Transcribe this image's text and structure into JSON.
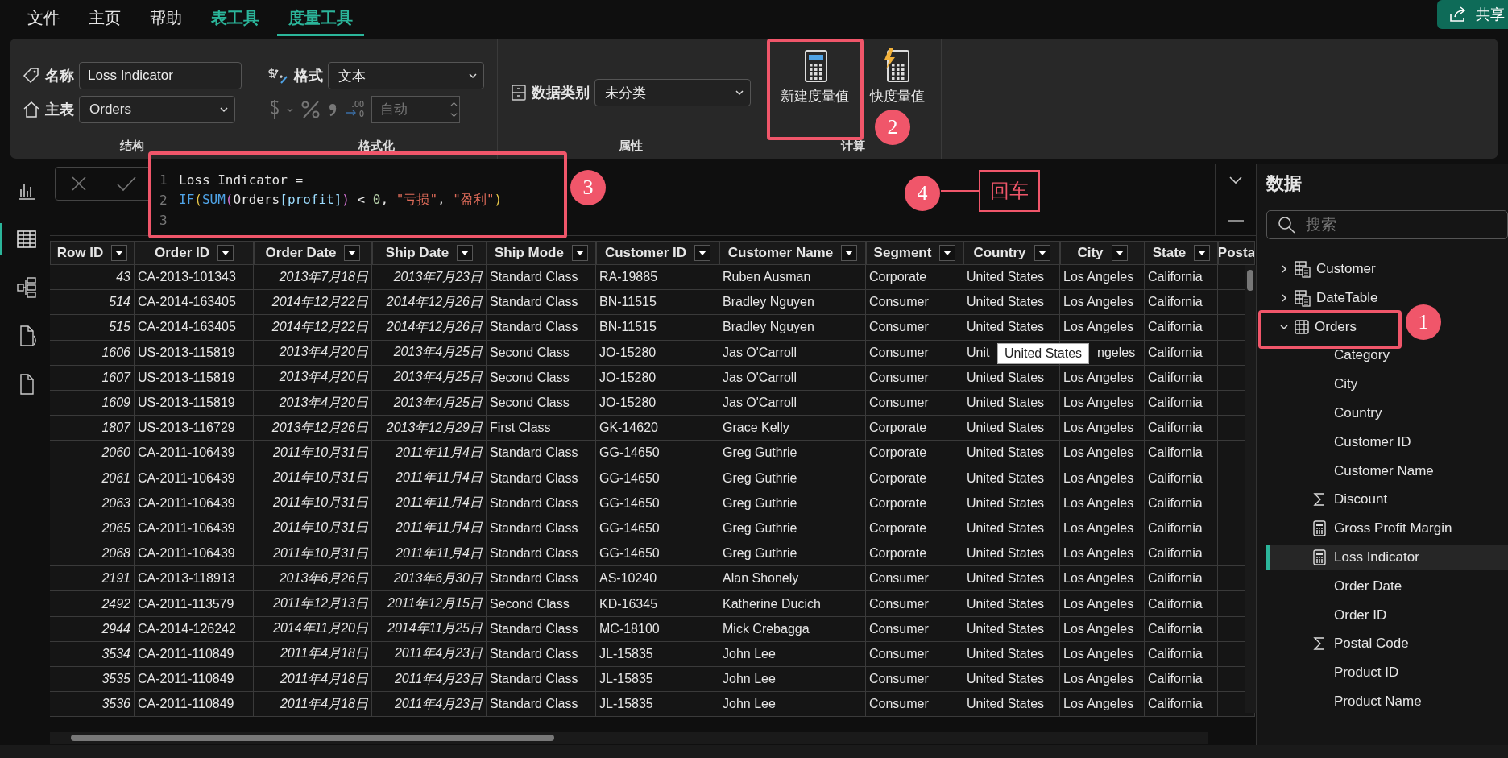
{
  "menu_tabs": [
    {
      "label": "文件",
      "selected": false,
      "contextual": false
    },
    {
      "label": "主页",
      "selected": false,
      "contextual": false
    },
    {
      "label": "帮助",
      "selected": false,
      "contextual": false
    },
    {
      "label": "表工具",
      "selected": false,
      "contextual": true
    },
    {
      "label": "度量工具",
      "selected": true,
      "contextual": true
    }
  ],
  "share_button": "共享",
  "ribbon": {
    "groups": [
      {
        "title": "结构",
        "kind": "structure",
        "name_label": "名称",
        "name_value": "Loss Indicator",
        "home_label": "主表",
        "home_value": "Orders"
      },
      {
        "title": "格式化",
        "kind": "format",
        "format_label": "格式",
        "format_value": "文本",
        "decimals_placeholder": "自动"
      },
      {
        "title": "属性",
        "kind": "properties",
        "category_label": "数据类别",
        "category_value": "未分类"
      },
      {
        "title": "计算",
        "kind": "calc",
        "buttons": [
          {
            "label": "新建度量值",
            "kind": "new"
          },
          {
            "label": "快度量值",
            "kind": "quick"
          }
        ]
      }
    ]
  },
  "formula": {
    "lines": [
      {
        "number": "1",
        "tokens": [
          {
            "t": "Loss Indicator =",
            "kind": "plain"
          }
        ]
      },
      {
        "number": "2",
        "tokens": [
          {
            "t": "IF",
            "kind": "func"
          },
          {
            "t": "(",
            "kind": "paren"
          },
          {
            "t": "SUM",
            "kind": "func"
          },
          {
            "t": "(",
            "kind": "paren2"
          },
          {
            "t": "Orders",
            "kind": "plain"
          },
          {
            "t": "[profit]",
            "kind": "column"
          },
          {
            "t": ")",
            "kind": "paren2"
          },
          {
            "t": " < ",
            "kind": "plain"
          },
          {
            "t": "0",
            "kind": "number"
          },
          {
            "t": ", ",
            "kind": "plain"
          },
          {
            "t": "\"亏损\"",
            "kind": "string"
          },
          {
            "t": ", ",
            "kind": "plain"
          },
          {
            "t": "\"盈利\"",
            "kind": "string"
          },
          {
            "t": ")",
            "kind": "paren"
          }
        ]
      },
      {
        "number": "3"
      }
    ]
  },
  "annotations": [
    {
      "kind": "badge",
      "text": "1"
    },
    {
      "kind": "badge",
      "text": "2"
    },
    {
      "kind": "badge",
      "text": "3"
    },
    {
      "kind": "badge",
      "text": "4"
    },
    {
      "kind": "label",
      "text": "回车"
    }
  ],
  "left_rail": [
    {
      "kind": "report",
      "selected": false
    },
    {
      "kind": "table",
      "selected": true
    },
    {
      "kind": "model",
      "selected": false
    },
    {
      "kind": "dax",
      "selected": false
    },
    {
      "kind": "tmdl",
      "selected": false
    }
  ],
  "table": {
    "columns": [
      {
        "name": "Row ID",
        "kind": "number"
      },
      {
        "name": "Order ID",
        "kind": "text"
      },
      {
        "name": "Order Date",
        "kind": "date"
      },
      {
        "name": "Ship Date",
        "kind": "date"
      },
      {
        "name": "Ship Mode",
        "kind": "text"
      },
      {
        "name": "Customer ID",
        "kind": "text"
      },
      {
        "name": "Customer Name",
        "kind": "text"
      },
      {
        "name": "Segment",
        "kind": "text"
      },
      {
        "name": "Country",
        "kind": "text"
      },
      {
        "name": "City",
        "kind": "text"
      },
      {
        "name": "State",
        "kind": "text"
      },
      {
        "name": "Posta",
        "kind": "cut"
      }
    ],
    "rows": [
      {
        "cells": [
          "43",
          "CA-2013-101343",
          "2013年7月18日",
          "2013年7月23日",
          "Standard Class",
          "RA-19885",
          "Ruben Ausman",
          "Corporate",
          "United States",
          "Los Angeles",
          "California"
        ]
      },
      {
        "cells": [
          "514",
          "CA-2014-163405",
          "2014年12月22日",
          "2014年12月26日",
          "Standard Class",
          "BN-11515",
          "Bradley Nguyen",
          "Consumer",
          "United States",
          "Los Angeles",
          "California"
        ]
      },
      {
        "cells": [
          "515",
          "CA-2014-163405",
          "2014年12月22日",
          "2014年12月26日",
          "Standard Class",
          "BN-11515",
          "Bradley Nguyen",
          "Consumer",
          "United States",
          "Los Angeles",
          "California"
        ]
      },
      {
        "cells": [
          "1606",
          "US-2013-115819",
          "2013年4月20日",
          "2013年4月25日",
          "Second Class",
          "JO-15280",
          "Jas O'Carroll",
          "Consumer",
          "Unit",
          "ngeles",
          "California"
        ],
        "tooltip": "United States"
      },
      {
        "cells": [
          "1607",
          "US-2013-115819",
          "2013年4月20日",
          "2013年4月25日",
          "Second Class",
          "JO-15280",
          "Jas O'Carroll",
          "Consumer",
          "United States",
          "Los Angeles",
          "California"
        ]
      },
      {
        "cells": [
          "1609",
          "US-2013-115819",
          "2013年4月20日",
          "2013年4月25日",
          "Second Class",
          "JO-15280",
          "Jas O'Carroll",
          "Consumer",
          "United States",
          "Los Angeles",
          "California"
        ]
      },
      {
        "cells": [
          "1807",
          "US-2013-116729",
          "2013年12月26日",
          "2013年12月29日",
          "First Class",
          "GK-14620",
          "Grace Kelly",
          "Corporate",
          "United States",
          "Los Angeles",
          "California"
        ]
      },
      {
        "cells": [
          "2060",
          "CA-2011-106439",
          "2011年10月31日",
          "2011年11月4日",
          "Standard Class",
          "GG-14650",
          "Greg Guthrie",
          "Corporate",
          "United States",
          "Los Angeles",
          "California"
        ]
      },
      {
        "cells": [
          "2061",
          "CA-2011-106439",
          "2011年10月31日",
          "2011年11月4日",
          "Standard Class",
          "GG-14650",
          "Greg Guthrie",
          "Corporate",
          "United States",
          "Los Angeles",
          "California"
        ]
      },
      {
        "cells": [
          "2063",
          "CA-2011-106439",
          "2011年10月31日",
          "2011年11月4日",
          "Standard Class",
          "GG-14650",
          "Greg Guthrie",
          "Corporate",
          "United States",
          "Los Angeles",
          "California"
        ]
      },
      {
        "cells": [
          "2065",
          "CA-2011-106439",
          "2011年10月31日",
          "2011年11月4日",
          "Standard Class",
          "GG-14650",
          "Greg Guthrie",
          "Corporate",
          "United States",
          "Los Angeles",
          "California"
        ]
      },
      {
        "cells": [
          "2068",
          "CA-2011-106439",
          "2011年10月31日",
          "2011年11月4日",
          "Standard Class",
          "GG-14650",
          "Greg Guthrie",
          "Corporate",
          "United States",
          "Los Angeles",
          "California"
        ]
      },
      {
        "cells": [
          "2191",
          "CA-2013-118913",
          "2013年6月26日",
          "2013年6月30日",
          "Standard Class",
          "AS-10240",
          "Alan Shonely",
          "Consumer",
          "United States",
          "Los Angeles",
          "California"
        ]
      },
      {
        "cells": [
          "2492",
          "CA-2011-113579",
          "2011年12月13日",
          "2011年12月15日",
          "Second Class",
          "KD-16345",
          "Katherine Ducich",
          "Consumer",
          "United States",
          "Los Angeles",
          "California"
        ]
      },
      {
        "cells": [
          "2944",
          "CA-2014-126242",
          "2014年11月20日",
          "2014年11月25日",
          "Standard Class",
          "MC-18100",
          "Mick Crebagga",
          "Consumer",
          "United States",
          "Los Angeles",
          "California"
        ]
      },
      {
        "cells": [
          "3534",
          "CA-2011-110849",
          "2011年4月18日",
          "2011年4月23日",
          "Standard Class",
          "JL-15835",
          "John Lee",
          "Consumer",
          "United States",
          "Los Angeles",
          "California"
        ]
      },
      {
        "cells": [
          "3535",
          "CA-2011-110849",
          "2011年4月18日",
          "2011年4月23日",
          "Standard Class",
          "JL-15835",
          "John Lee",
          "Consumer",
          "United States",
          "Los Angeles",
          "California"
        ]
      },
      {
        "cells": [
          "3536",
          "CA-2011-110849",
          "2011年4月18日",
          "2011年4月23日",
          "Standard Class",
          "JL-15835",
          "John Lee",
          "Consumer",
          "United States",
          "Los Angeles",
          "California"
        ]
      }
    ]
  },
  "data_pane": {
    "title": "数据",
    "search_placeholder": "搜索",
    "tables": [
      {
        "name": "Customer",
        "kind": "table",
        "expanded": false
      },
      {
        "name": "DateTable",
        "kind": "table",
        "expanded": false
      },
      {
        "name": "Orders",
        "kind": "grid",
        "expanded": true,
        "children": [
          {
            "name": "Category",
            "kind": "field",
            "selected": false
          },
          {
            "name": "City",
            "kind": "field",
            "selected": false
          },
          {
            "name": "Country",
            "kind": "field",
            "selected": false
          },
          {
            "name": "Customer ID",
            "kind": "field",
            "selected": false
          },
          {
            "name": "Customer Name",
            "kind": "field",
            "selected": false
          },
          {
            "name": "Discount",
            "kind": "sum",
            "selected": false
          },
          {
            "name": "Gross Profit Margin",
            "kind": "measure",
            "selected": false
          },
          {
            "name": "Loss Indicator",
            "kind": "measure",
            "selected": true
          },
          {
            "name": "Order Date",
            "kind": "field",
            "selected": false
          },
          {
            "name": "Order ID",
            "kind": "field",
            "selected": false
          },
          {
            "name": "Postal Code",
            "kind": "sum",
            "selected": false
          },
          {
            "name": "Product ID",
            "kind": "field",
            "selected": false
          },
          {
            "name": "Product Name",
            "kind": "field",
            "selected": false
          }
        ]
      }
    ]
  }
}
